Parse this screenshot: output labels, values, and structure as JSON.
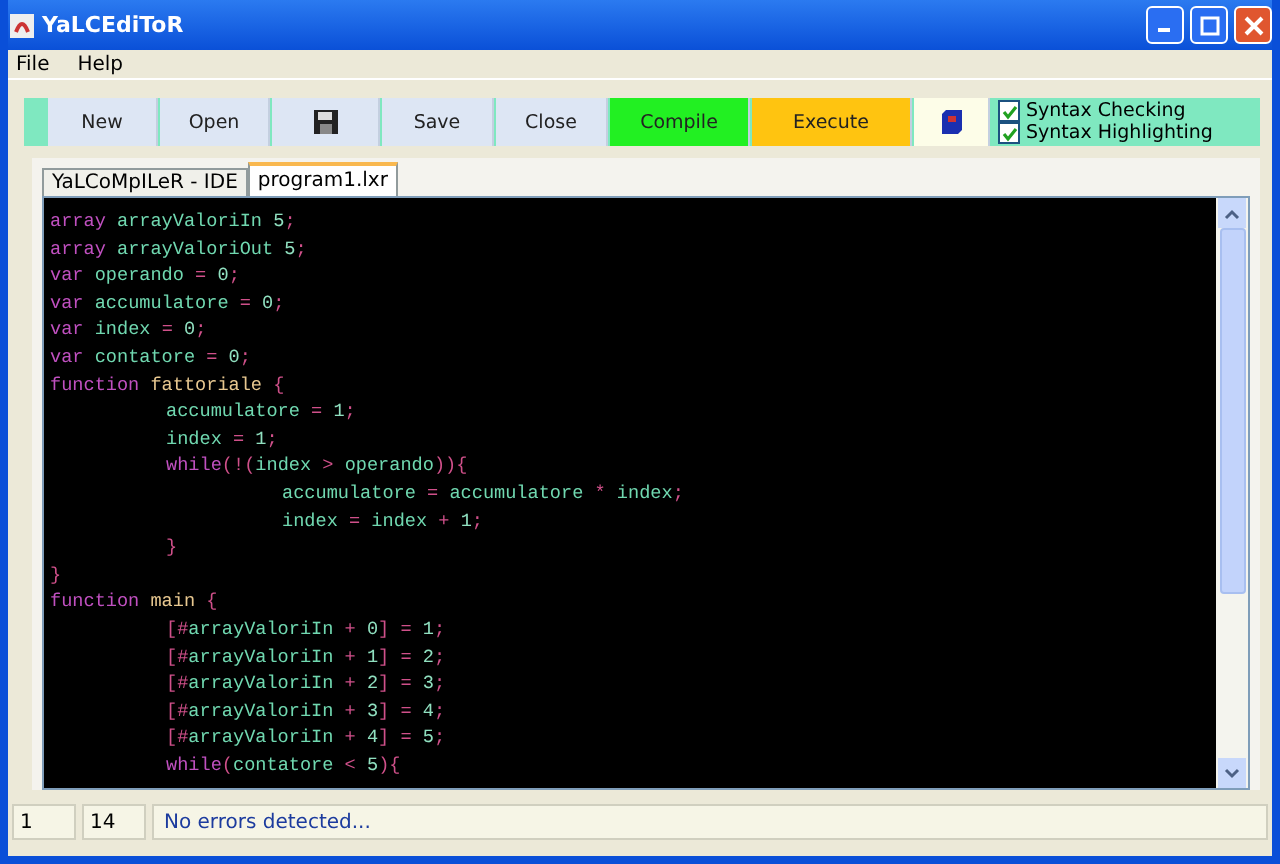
{
  "window": {
    "title": "YaLCEdiToR"
  },
  "menu": [
    "File",
    "Help"
  ],
  "toolbar": {
    "buttons": [
      {
        "kind": "text",
        "label": "New",
        "color": "#dde6f4"
      },
      {
        "kind": "text",
        "label": "Open",
        "color": "#dde6f4"
      },
      {
        "kind": "disk",
        "color": "#dde6f4"
      },
      {
        "kind": "text",
        "label": "Save",
        "color": "#dde6f4"
      },
      {
        "kind": "text",
        "label": "Close",
        "color": "#dde6f4"
      },
      {
        "kind": "text",
        "label": "Compile",
        "color": "#22f022"
      },
      {
        "kind": "text",
        "label": "Execute",
        "color": "#ffc410"
      },
      {
        "kind": "book",
        "color": "#fdfde8"
      }
    ],
    "options": [
      {
        "label": "Syntax Checking",
        "checked": true
      },
      {
        "label": "Syntax Highlighting",
        "checked": true
      }
    ]
  },
  "tabs": [
    {
      "label": "YaLCoMpILeR - IDE",
      "selected": false
    },
    {
      "label": "program1.lxr",
      "selected": true
    }
  ],
  "editor": {
    "lines": [
      {
        "tokens": [
          {
            "kind": "keyword",
            "text": "array"
          },
          {
            "kind": "ident",
            "text": " arrayValoriIn"
          },
          {
            "kind": "number",
            "text": " 5"
          },
          {
            "kind": "op",
            "text": ";"
          }
        ]
      },
      {
        "tokens": [
          {
            "kind": "keyword",
            "text": "array"
          },
          {
            "kind": "ident",
            "text": " arrayValoriOut"
          },
          {
            "kind": "number",
            "text": " 5"
          },
          {
            "kind": "op",
            "text": ";"
          }
        ]
      },
      {
        "tokens": [
          {
            "kind": "keyword",
            "text": "var"
          },
          {
            "kind": "ident",
            "text": " operando"
          },
          {
            "kind": "op",
            "text": " ="
          },
          {
            "kind": "number",
            "text": " 0"
          },
          {
            "kind": "op",
            "text": ";"
          }
        ]
      },
      {
        "tokens": [
          {
            "kind": "keyword",
            "text": "var"
          },
          {
            "kind": "ident",
            "text": " accumulatore"
          },
          {
            "kind": "op",
            "text": " ="
          },
          {
            "kind": "number",
            "text": " 0"
          },
          {
            "kind": "op",
            "text": ";"
          }
        ]
      },
      {
        "tokens": [
          {
            "kind": "keyword",
            "text": "var"
          },
          {
            "kind": "ident",
            "text": " index"
          },
          {
            "kind": "op",
            "text": " ="
          },
          {
            "kind": "number",
            "text": " 0"
          },
          {
            "kind": "op",
            "text": ";"
          }
        ]
      },
      {
        "tokens": [
          {
            "kind": "keyword",
            "text": "var"
          },
          {
            "kind": "ident",
            "text": " contatore"
          },
          {
            "kind": "op",
            "text": " ="
          },
          {
            "kind": "number",
            "text": " 0"
          },
          {
            "kind": "op",
            "text": ";"
          }
        ]
      },
      {
        "tokens": [
          {
            "kind": "keyword",
            "text": "function"
          },
          {
            "kind": "name",
            "text": " fattoriale"
          },
          {
            "kind": "op",
            "text": " {"
          }
        ],
        "children": [
          {
            "tokens": [
              {
                "kind": "ident",
                "text": "accumulatore"
              },
              {
                "kind": "op",
                "text": " ="
              },
              {
                "kind": "number",
                "text": " 1"
              },
              {
                "kind": "op",
                "text": ";"
              }
            ]
          },
          {
            "tokens": [
              {
                "kind": "ident",
                "text": "index"
              },
              {
                "kind": "op",
                "text": " ="
              },
              {
                "kind": "number",
                "text": " 1"
              },
              {
                "kind": "op",
                "text": ";"
              }
            ]
          },
          {
            "tokens": [
              {
                "kind": "keyword",
                "text": "while"
              },
              {
                "kind": "op",
                "text": "(!("
              },
              {
                "kind": "ident",
                "text": "index"
              },
              {
                "kind": "op",
                "text": " >"
              },
              {
                "kind": "ident",
                "text": " operando"
              },
              {
                "kind": "op",
                "text": ")){"
              }
            ],
            "children": [
              {
                "tokens": [
                  {
                    "kind": "ident",
                    "text": "accumulatore"
                  },
                  {
                    "kind": "op",
                    "text": " ="
                  },
                  {
                    "kind": "ident",
                    "text": " accumulatore"
                  },
                  {
                    "kind": "op",
                    "text": " *"
                  },
                  {
                    "kind": "ident",
                    "text": " index"
                  },
                  {
                    "kind": "op",
                    "text": ";"
                  }
                ]
              },
              {
                "tokens": [
                  {
                    "kind": "ident",
                    "text": "index"
                  },
                  {
                    "kind": "op",
                    "text": " ="
                  },
                  {
                    "kind": "ident",
                    "text": " index"
                  },
                  {
                    "kind": "op",
                    "text": " +"
                  },
                  {
                    "kind": "number",
                    "text": " 1"
                  },
                  {
                    "kind": "op",
                    "text": ";"
                  }
                ]
              }
            ]
          },
          {
            "tokens": [
              {
                "kind": "op",
                "text": "}"
              }
            ]
          }
        ]
      },
      {
        "tokens": [
          {
            "kind": "op",
            "text": "}"
          }
        ]
      },
      {
        "tokens": [
          {
            "kind": "keyword",
            "text": "function"
          },
          {
            "kind": "name",
            "text": " main"
          },
          {
            "kind": "op",
            "text": " {"
          }
        ],
        "children": [
          {
            "tokens": [
              {
                "kind": "op",
                "text": "[#"
              },
              {
                "kind": "ident",
                "text": "arrayValoriIn"
              },
              {
                "kind": "op",
                "text": " +"
              },
              {
                "kind": "number",
                "text": " 0"
              },
              {
                "kind": "op",
                "text": "] ="
              },
              {
                "kind": "number",
                "text": " 1"
              },
              {
                "kind": "op",
                "text": ";"
              }
            ]
          },
          {
            "tokens": [
              {
                "kind": "op",
                "text": "[#"
              },
              {
                "kind": "ident",
                "text": "arrayValoriIn"
              },
              {
                "kind": "op",
                "text": " +"
              },
              {
                "kind": "number",
                "text": " 1"
              },
              {
                "kind": "op",
                "text": "] ="
              },
              {
                "kind": "number",
                "text": " 2"
              },
              {
                "kind": "op",
                "text": ";"
              }
            ]
          },
          {
            "tokens": [
              {
                "kind": "op",
                "text": "[#"
              },
              {
                "kind": "ident",
                "text": "arrayValoriIn"
              },
              {
                "kind": "op",
                "text": " +"
              },
              {
                "kind": "number",
                "text": " 2"
              },
              {
                "kind": "op",
                "text": "] ="
              },
              {
                "kind": "number",
                "text": " 3"
              },
              {
                "kind": "op",
                "text": ";"
              }
            ]
          },
          {
            "tokens": [
              {
                "kind": "op",
                "text": "[#"
              },
              {
                "kind": "ident",
                "text": "arrayValoriIn"
              },
              {
                "kind": "op",
                "text": " +"
              },
              {
                "kind": "number",
                "text": " 3"
              },
              {
                "kind": "op",
                "text": "] ="
              },
              {
                "kind": "number",
                "text": " 4"
              },
              {
                "kind": "op",
                "text": ";"
              }
            ]
          },
          {
            "tokens": [
              {
                "kind": "op",
                "text": "[#"
              },
              {
                "kind": "ident",
                "text": "arrayValoriIn"
              },
              {
                "kind": "op",
                "text": " +"
              },
              {
                "kind": "number",
                "text": " 4"
              },
              {
                "kind": "op",
                "text": "] ="
              },
              {
                "kind": "number",
                "text": " 5"
              },
              {
                "kind": "op",
                "text": ";"
              }
            ]
          },
          {
            "tokens": [
              {
                "kind": "keyword",
                "text": "while"
              },
              {
                "kind": "op",
                "text": "("
              },
              {
                "kind": "ident",
                "text": "contatore"
              },
              {
                "kind": "op",
                "text": " <"
              },
              {
                "kind": "number",
                "text": " 5"
              },
              {
                "kind": "op",
                "text": "){"
              }
            ]
          }
        ]
      }
    ]
  },
  "status_bar": {
    "line": "1",
    "column": "14",
    "message": "No errors detected..."
  }
}
